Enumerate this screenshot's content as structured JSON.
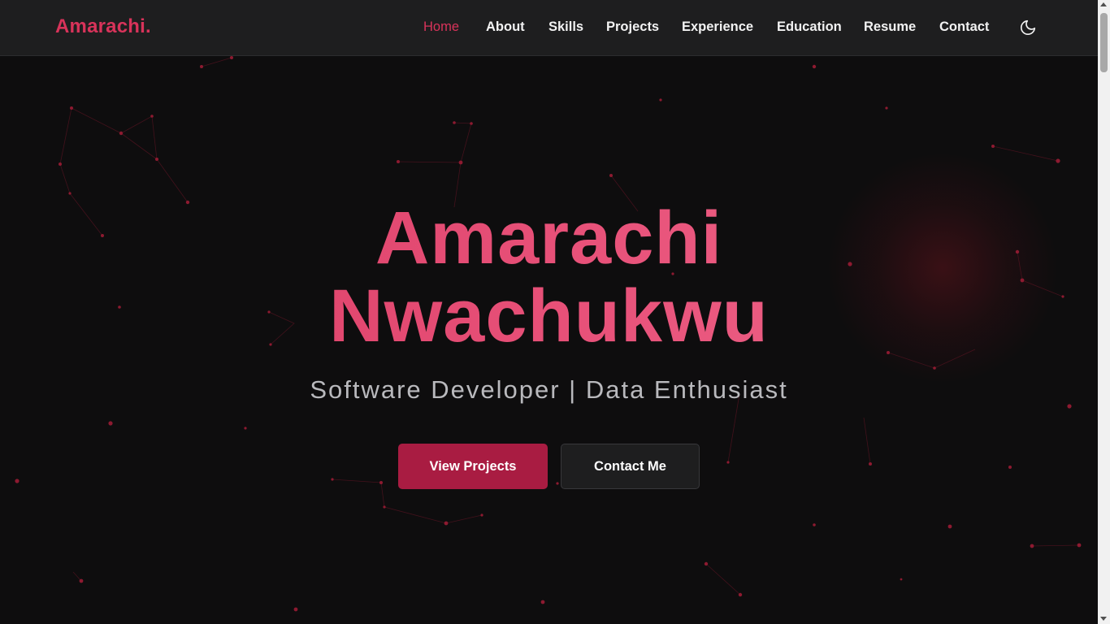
{
  "brand": {
    "name": "Amarachi."
  },
  "nav": {
    "items": [
      {
        "label": "Home",
        "active": true
      },
      {
        "label": "About"
      },
      {
        "label": "Skills"
      },
      {
        "label": "Projects"
      },
      {
        "label": "Experience"
      },
      {
        "label": "Education"
      },
      {
        "label": "Resume"
      },
      {
        "label": "Contact"
      }
    ],
    "theme_icon": "moon-icon"
  },
  "hero": {
    "first_name": "Amarachi",
    "last_name": "Nwachukwu",
    "tagline": "Software Developer | Data Enthusiast",
    "primary_button": "View Projects",
    "secondary_button": "Contact Me"
  },
  "colors": {
    "accent": "#d8335a",
    "button_primary": "#a91c42",
    "background": "#0e0d0e",
    "navbar": "#1e1e1f"
  }
}
